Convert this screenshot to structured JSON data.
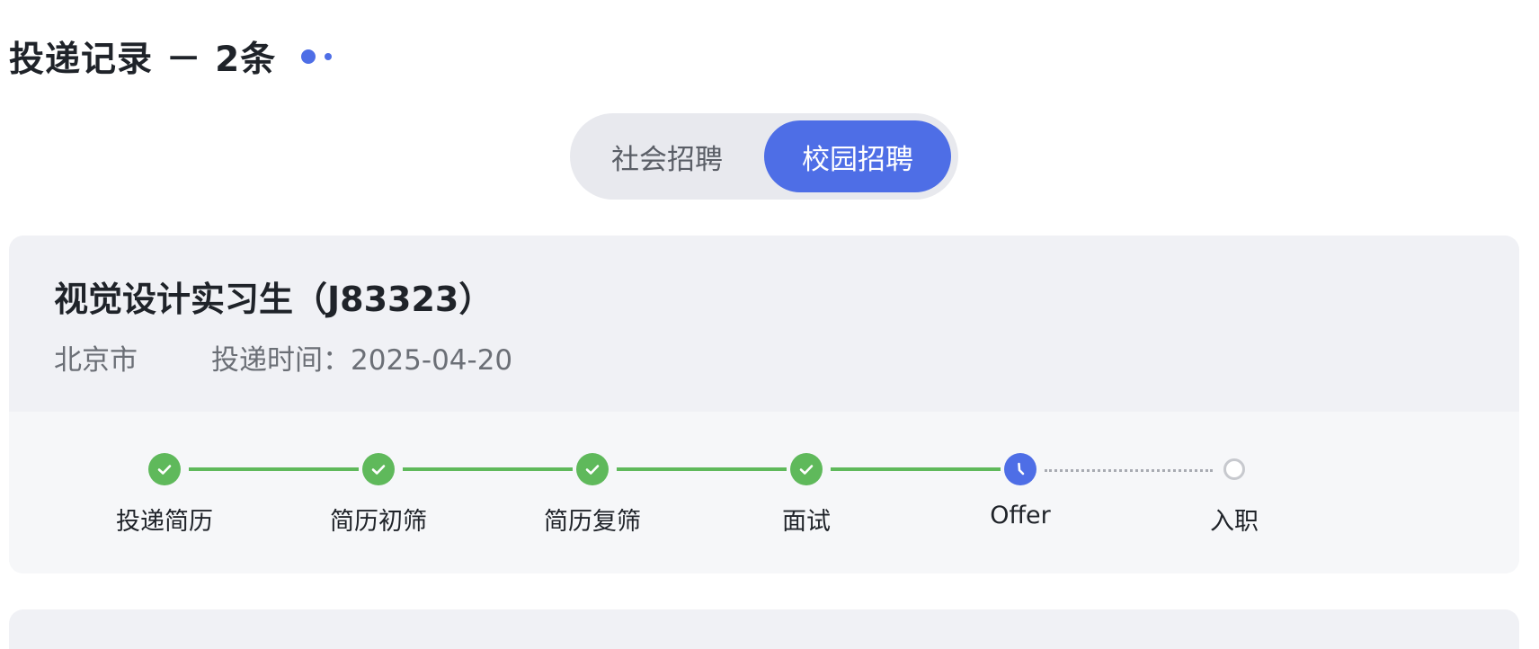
{
  "header": {
    "title": "投递记录 － 2条"
  },
  "tabs": {
    "social_label": "社会招聘",
    "campus_label": "校园招聘",
    "selected": "校园招聘",
    "accent_color": "#4e6ee6"
  },
  "job": {
    "title": "视觉设计实习生（J83323）",
    "city": "北京市",
    "applied_label": "投递时间：",
    "applied_date": "2025-04-20"
  },
  "progress": {
    "done_color": "#5fb95b",
    "steps": [
      {
        "label": "投递简历",
        "status": "done",
        "icon": "check-icon"
      },
      {
        "label": "简历初筛",
        "status": "done",
        "icon": "check-icon"
      },
      {
        "label": "简历复筛",
        "status": "done",
        "icon": "check-icon"
      },
      {
        "label": "面试",
        "status": "done",
        "icon": "check-icon"
      },
      {
        "label": "Offer",
        "status": "current",
        "icon": "clock-icon"
      },
      {
        "label": "入职",
        "status": "pending",
        "icon": "empty-circle-icon"
      }
    ]
  }
}
